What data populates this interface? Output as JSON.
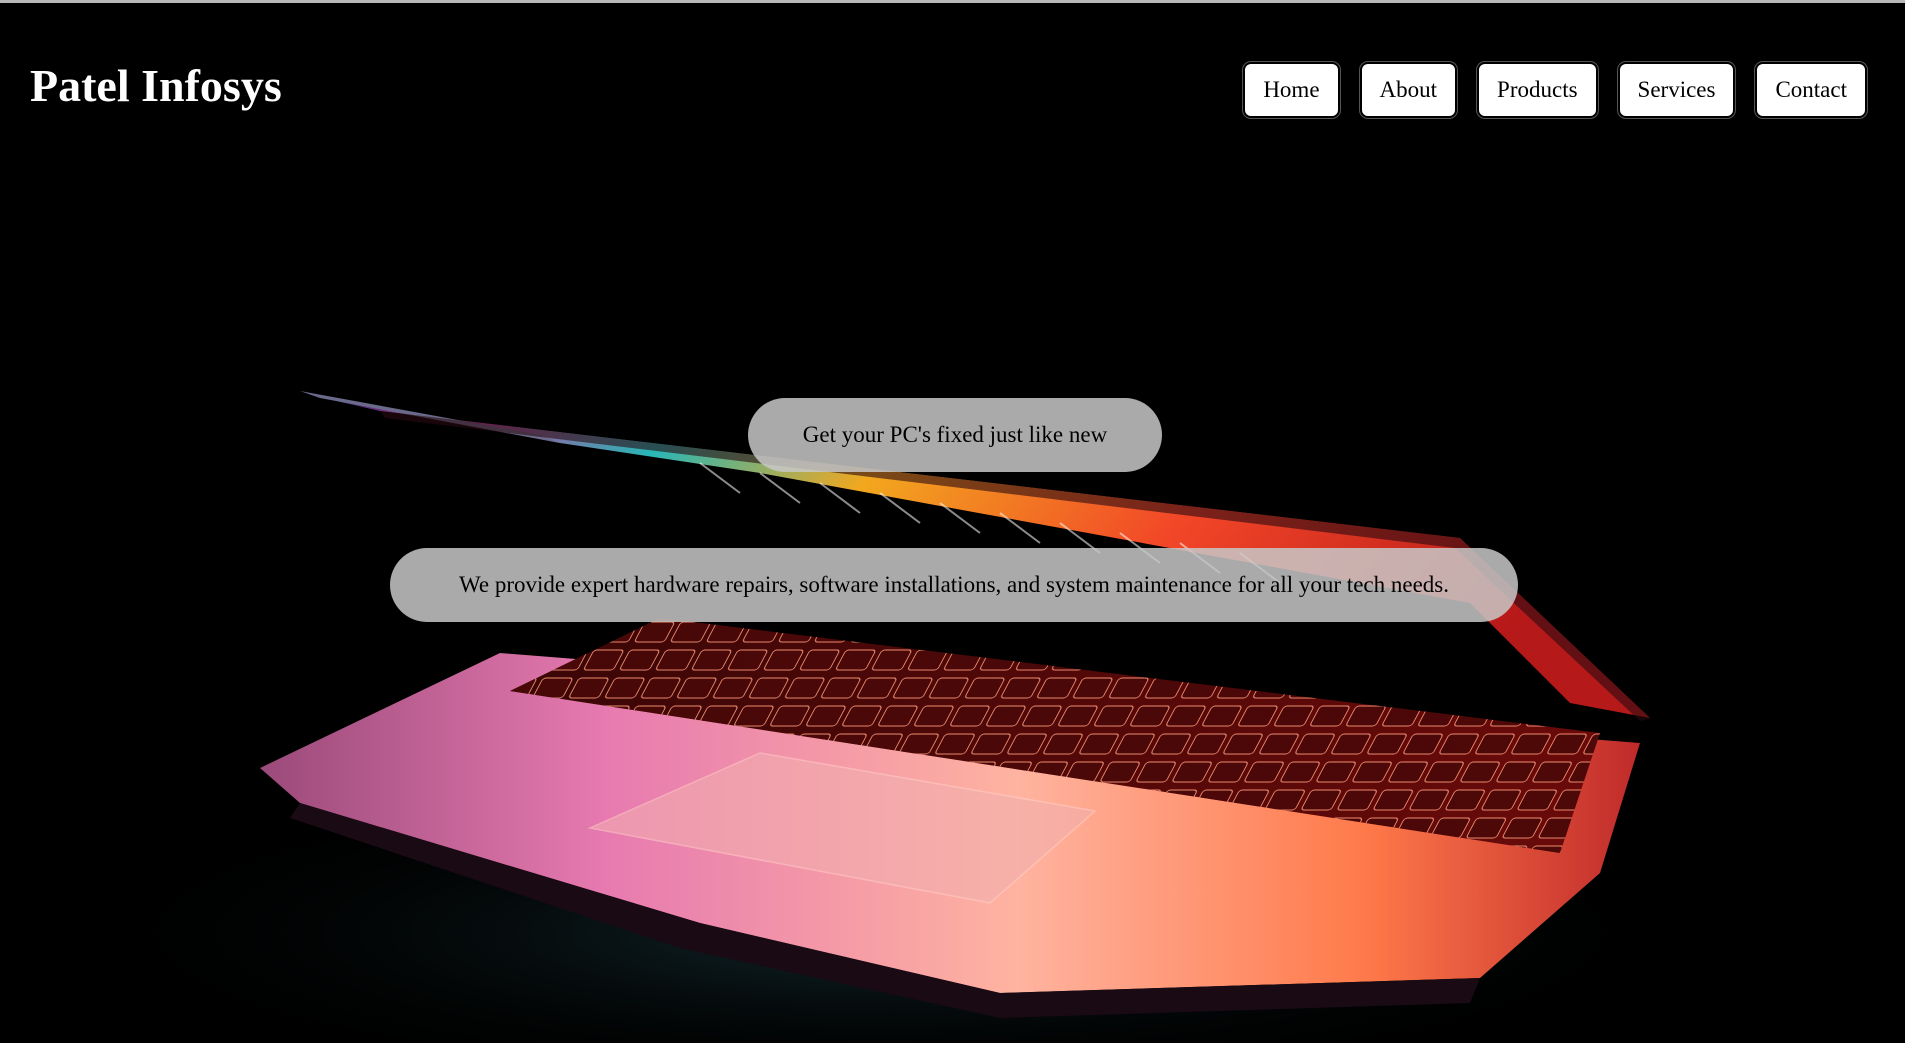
{
  "brand": {
    "name": "Patel Infosys"
  },
  "nav": {
    "items": [
      "Home",
      "About",
      "Products",
      "Services",
      "Contact"
    ]
  },
  "hero": {
    "tagline": "Get your PC's fixed just like new",
    "description": "We provide expert hardware repairs, software installations, and system maintenance for all your tech needs.",
    "background_image": "open-laptop-icon",
    "colors": {
      "background": "#000000",
      "pill": "#c8c8c8",
      "keyboard_glow": "#ff5a2a"
    }
  }
}
